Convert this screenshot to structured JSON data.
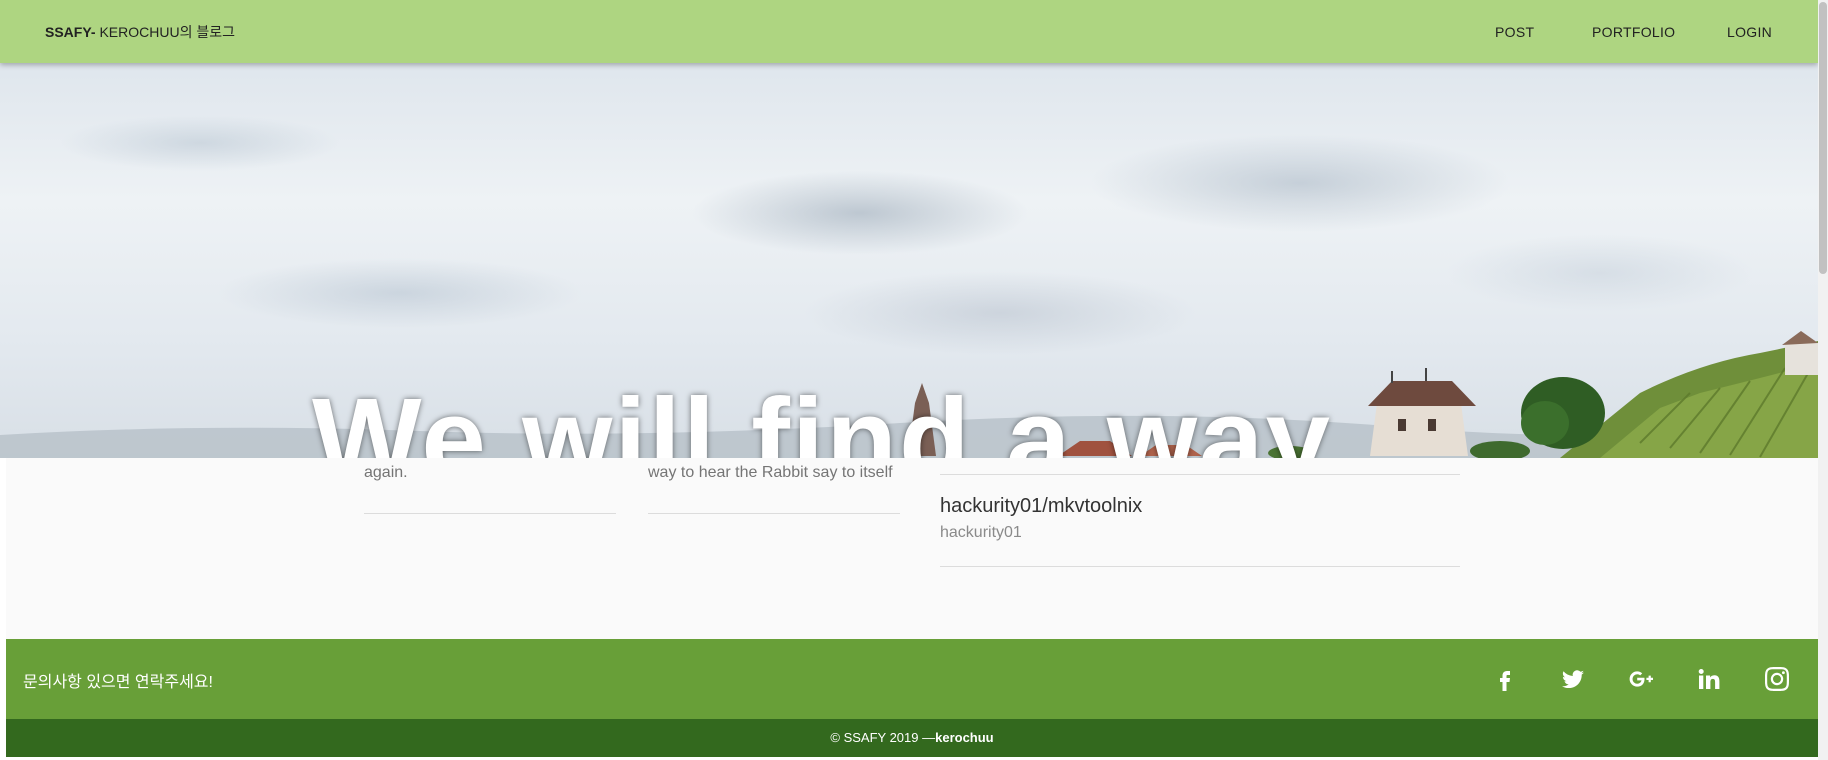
{
  "navbar": {
    "brand_bold": "SSAFY-",
    "brand_rest": " KEROCHUU의 블로그",
    "items": [
      {
        "label": "POST"
      },
      {
        "label": "PORTFOLIO"
      },
      {
        "label": "LOGIN"
      }
    ]
  },
  "hero": {
    "title": "We will find a way"
  },
  "content": {
    "card1_text": "again.",
    "card2_text": "way to hear the Rabbit say to itself",
    "repo": {
      "title": "hackurity01/mkvtoolnix",
      "owner": "hackurity01"
    }
  },
  "footer": {
    "contact_text": "문의사항 있으면 연락주세요!",
    "social_icons": [
      "facebook-icon",
      "twitter-icon",
      "google-plus-icon",
      "linkedin-icon",
      "instagram-icon"
    ],
    "copyright_prefix": "© SSAFY 2019 —",
    "copyright_author": "kerochuu"
  },
  "colors": {
    "navbar": "#aed581",
    "footer": "#689f38",
    "copyright_bar": "#33691e",
    "content_bg": "#fafafa"
  }
}
